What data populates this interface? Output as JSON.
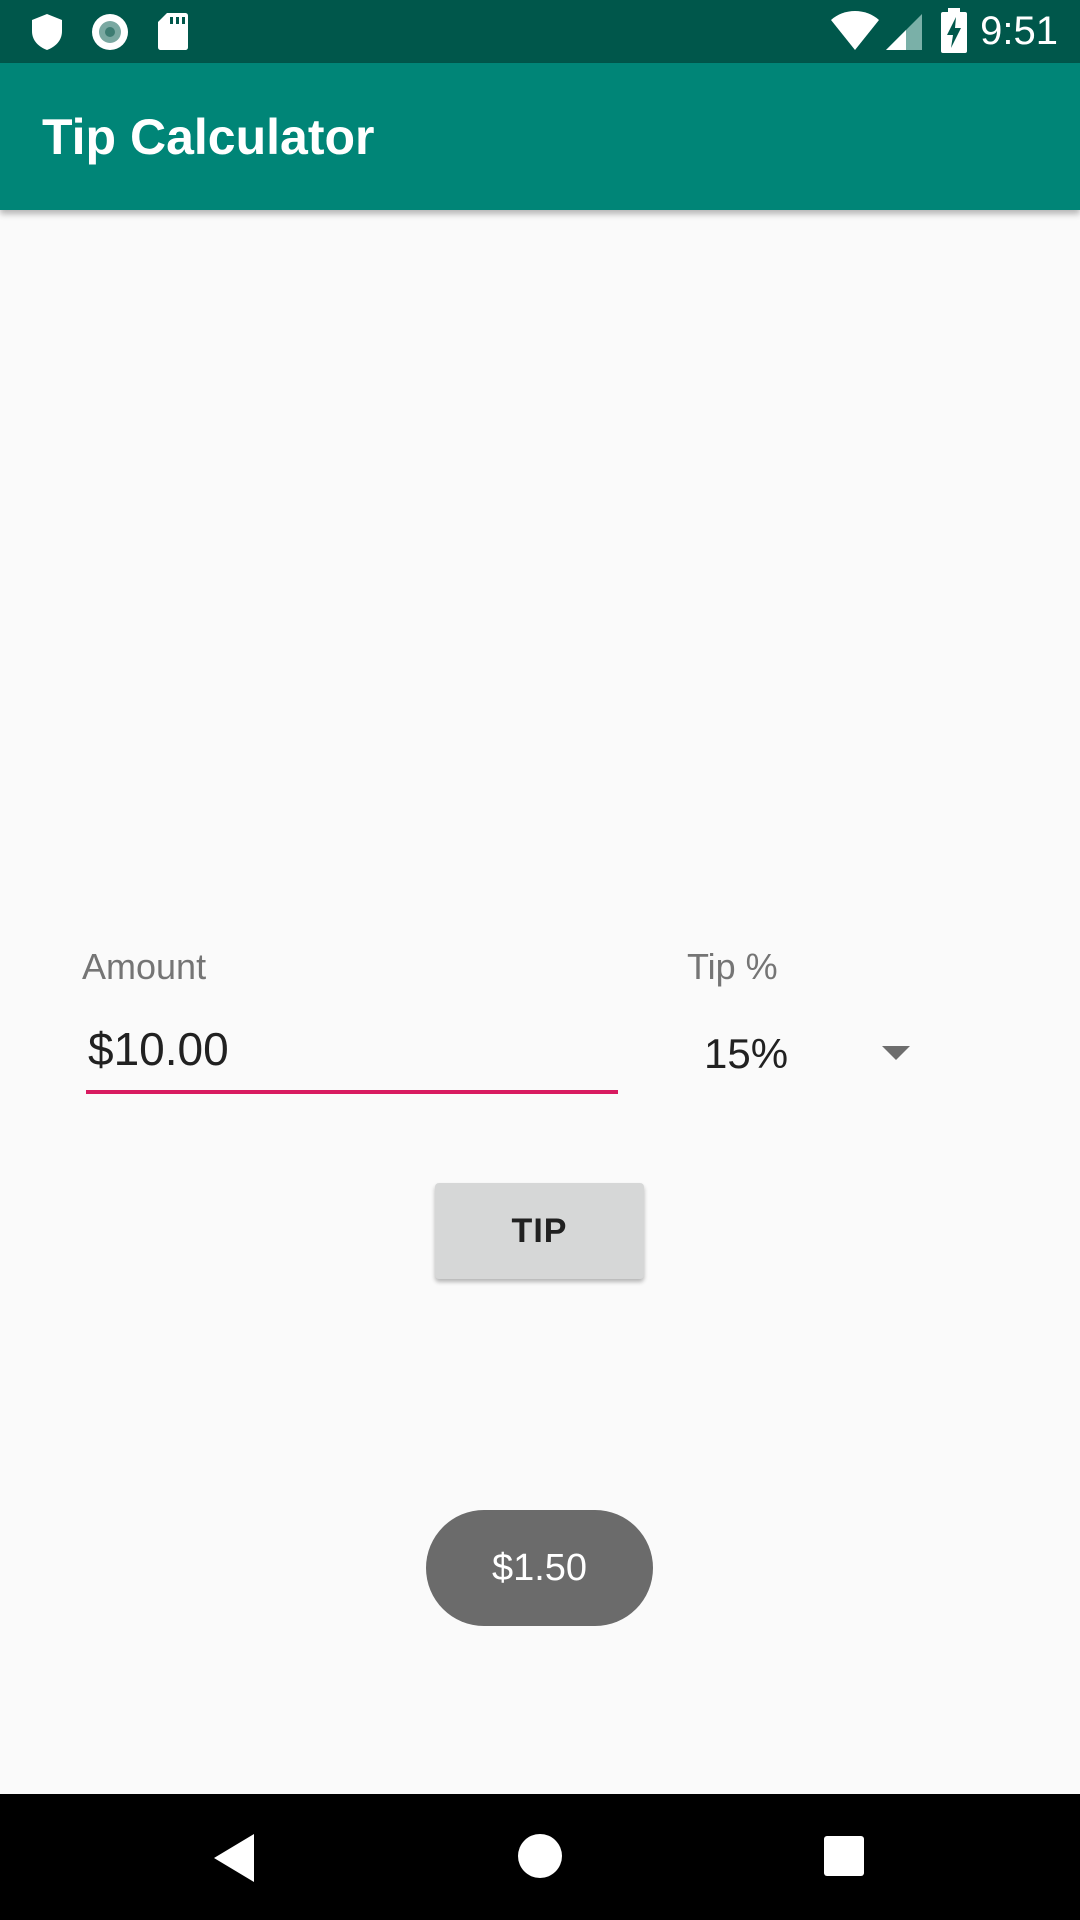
{
  "status_bar": {
    "time": "9:51",
    "icons": [
      "shield-icon",
      "circle-record-icon",
      "sd-card-icon",
      "wifi-icon",
      "signal-icon",
      "battery-charging-icon"
    ]
  },
  "app_bar": {
    "title": "Tip Calculator",
    "background_color": "#008577",
    "status_color": "#00574b"
  },
  "form": {
    "amount_label": "Amount",
    "amount_value": "$10.00",
    "tip_label": "Tip %",
    "tip_selected": "15%",
    "accent_color": "#d81b60"
  },
  "actions": {
    "tip_button_label": "TIP"
  },
  "toast": {
    "message": "$1.50"
  },
  "nav_bar": {
    "buttons": [
      "back",
      "home",
      "recents"
    ]
  }
}
